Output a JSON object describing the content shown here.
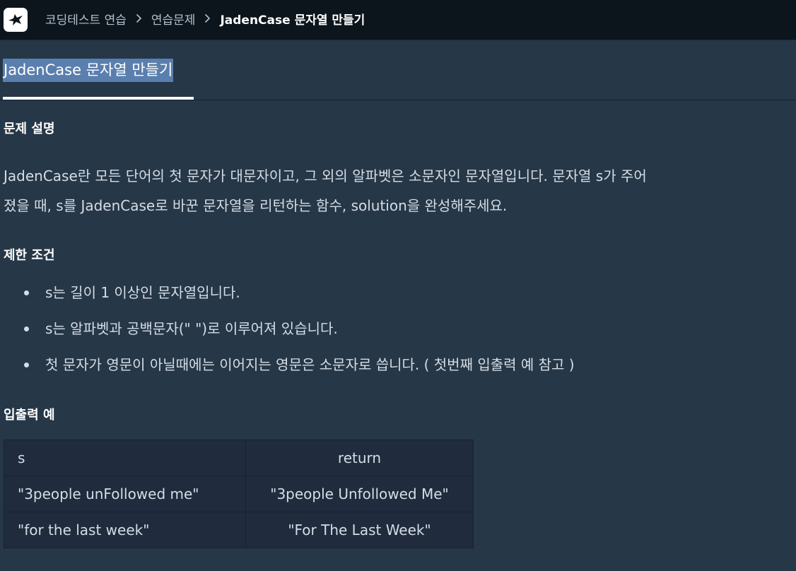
{
  "breadcrumb": {
    "items": [
      "코딩테스트 연습",
      "연습문제"
    ],
    "current": "JadenCase 문자열 만들기"
  },
  "tab": {
    "title": "JadenCase 문자열 만들기"
  },
  "sections": {
    "description_title": "문제 설명",
    "description_lines": [
      "JadenCase란 모든 단어의 첫 문자가 대문자이고, 그 외의 알파벳은 소문자인 문자열입니다. 문자열 s가 주어",
      "졌을 때, s를 JadenCase로 바꾼 문자열을 리턴하는 함수, solution을 완성해주세요."
    ],
    "constraints_title": "제한 조건",
    "constraints": [
      "s는 길이 1 이상인 문자열입니다.",
      "s는 알파벳과 공백문자(\" \")로 이루어져 있습니다.",
      "첫 문자가 영문이 아닐때에는 이어지는 영문은 소문자로 씁니다. ( 첫번째 입출력 예 참고 )"
    ],
    "examples_title": "입출력 예"
  },
  "table": {
    "headers": [
      "s",
      "return"
    ],
    "rows": [
      [
        "\"3people unFollowed me\"",
        "\"3people Unfollowed Me\""
      ],
      [
        "\"for the last week\"",
        "\"For The Last Week\""
      ]
    ]
  },
  "colors": {
    "background": "#263747",
    "topbar": "#0c151c",
    "tab_highlight": "#5a7fae",
    "table_bg": "#202b3d"
  },
  "icons": {
    "logo": "bird-logo-icon",
    "separator": "chevron-right-icon"
  }
}
